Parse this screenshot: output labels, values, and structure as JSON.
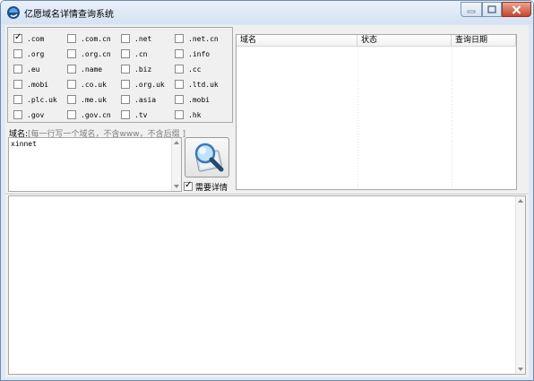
{
  "window": {
    "title": "亿愿域名详情查询系统"
  },
  "tlds": [
    {
      "label": ".com",
      "checked": true
    },
    {
      "label": ".com.cn",
      "checked": false
    },
    {
      "label": ".net",
      "checked": false
    },
    {
      "label": ".net.cn",
      "checked": false
    },
    {
      "label": ".org",
      "checked": false
    },
    {
      "label": ".org.cn",
      "checked": false
    },
    {
      "label": ".cn",
      "checked": false
    },
    {
      "label": ".info",
      "checked": false
    },
    {
      "label": ".eu",
      "checked": false
    },
    {
      "label": ".name",
      "checked": false
    },
    {
      "label": ".biz",
      "checked": false
    },
    {
      "label": ".cc",
      "checked": false
    },
    {
      "label": ".mobi",
      "checked": false
    },
    {
      "label": ".co.uk",
      "checked": false
    },
    {
      "label": ".org.uk",
      "checked": false
    },
    {
      "label": ".ltd.uk",
      "checked": false
    },
    {
      "label": ".plc.uk",
      "checked": false
    },
    {
      "label": ".me.uk",
      "checked": false
    },
    {
      "label": ".asia",
      "checked": false
    },
    {
      "label": ".mobi",
      "checked": false
    },
    {
      "label": ".gov",
      "checked": false
    },
    {
      "label": ".gov.cn",
      "checked": false
    },
    {
      "label": ".tv",
      "checked": false
    },
    {
      "label": ".hk",
      "checked": false
    }
  ],
  "domain_input": {
    "label": "域名:",
    "hint": "[每一行写一个域名，不含www，不含后缀 ]",
    "value": "xinnet"
  },
  "need_detail": {
    "label": "需要详情",
    "checked": true
  },
  "results_table": {
    "columns": [
      "域名",
      "状态",
      "查询日期"
    ],
    "rows": []
  },
  "icons": {
    "app": "globe-icon",
    "search": "magnifier-icon"
  },
  "colors": {
    "titlebar": "#dfe8f3",
    "close_button": "#c6452c",
    "client": "#f0f0f0"
  }
}
